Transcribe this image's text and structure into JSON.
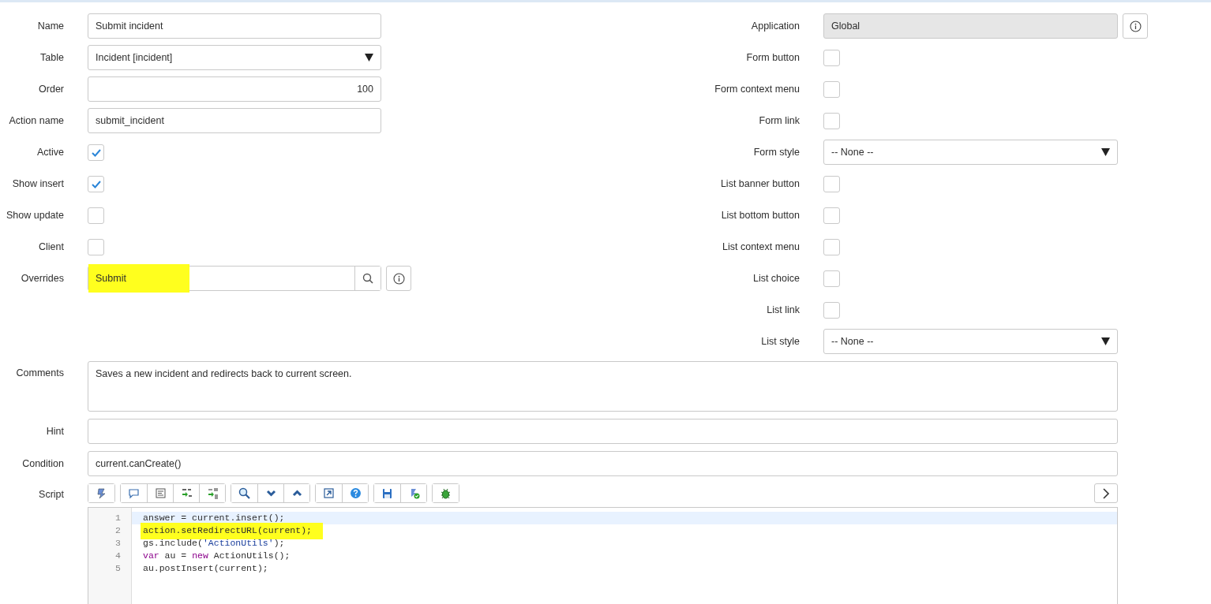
{
  "left_fields": [
    {
      "label": "Name",
      "kind": "text",
      "value": "Submit incident"
    },
    {
      "label": "Table",
      "kind": "select",
      "value": "Incident [incident]"
    },
    {
      "label": "Order",
      "kind": "number",
      "value": "100"
    },
    {
      "label": "Action name",
      "kind": "text",
      "value": "submit_incident"
    },
    {
      "label": "Active",
      "kind": "checkbox",
      "checked": true
    },
    {
      "label": "Show insert",
      "kind": "checkbox",
      "checked": true
    },
    {
      "label": "Show update",
      "kind": "checkbox",
      "checked": false
    },
    {
      "label": "Client",
      "kind": "checkbox",
      "checked": false
    },
    {
      "label": "Overrides",
      "kind": "reference",
      "value": "Submit",
      "highlighted": true
    }
  ],
  "right_fields": [
    {
      "label": "Application",
      "kind": "readonly",
      "value": "Global"
    },
    {
      "label": "Form button",
      "kind": "checkbox",
      "checked": false
    },
    {
      "label": "Form context menu",
      "kind": "checkbox",
      "checked": false
    },
    {
      "label": "Form link",
      "kind": "checkbox",
      "checked": false
    },
    {
      "label": "Form style",
      "kind": "select",
      "value": "-- None --"
    },
    {
      "label": "List banner button",
      "kind": "checkbox",
      "checked": false
    },
    {
      "label": "List bottom button",
      "kind": "checkbox",
      "checked": false
    },
    {
      "label": "List context menu",
      "kind": "checkbox",
      "checked": false
    },
    {
      "label": "List choice",
      "kind": "checkbox",
      "checked": false
    },
    {
      "label": "List link",
      "kind": "checkbox",
      "checked": false
    },
    {
      "label": "List style",
      "kind": "select",
      "value": "-- None --"
    }
  ],
  "wide_fields": [
    {
      "label": "Comments",
      "kind": "textarea",
      "value": "Saves a new incident and redirects back to current screen."
    },
    {
      "label": "Hint",
      "kind": "text"
    },
    {
      "label": "Condition",
      "kind": "text",
      "value": "current.canCreate()"
    }
  ],
  "script": {
    "label": "Script",
    "lines": [
      {
        "number": "1",
        "active": true,
        "highlighted": false,
        "tokens": [
          {
            "kind": "plain",
            "text": "answer = current.insert();"
          }
        ]
      },
      {
        "number": "2",
        "active": false,
        "highlighted": true,
        "tokens": [
          {
            "kind": "plain",
            "text": "action.setRedirectURL(current);"
          }
        ]
      },
      {
        "number": "3",
        "active": false,
        "highlighted": false,
        "tokens": [
          {
            "kind": "plain",
            "text": "gs.include("
          },
          {
            "kind": "string",
            "text": "'ActionUtils'"
          },
          {
            "kind": "plain",
            "text": ");"
          }
        ]
      },
      {
        "number": "4",
        "active": false,
        "highlighted": false,
        "tokens": [
          {
            "kind": "keyword",
            "text": "var"
          },
          {
            "kind": "plain",
            "text": " au = "
          },
          {
            "kind": "keyword",
            "text": "new"
          },
          {
            "kind": "plain",
            "text": " ActionUtils();"
          }
        ]
      },
      {
        "number": "5",
        "active": false,
        "highlighted": false,
        "tokens": [
          {
            "kind": "plain",
            "text": "au.postInsert(current);"
          }
        ]
      }
    ]
  }
}
